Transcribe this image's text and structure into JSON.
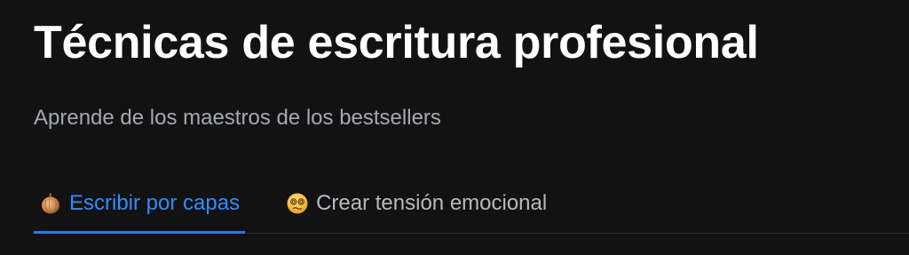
{
  "page": {
    "title": "Técnicas de escritura profesional",
    "subtitle": "Aprende de los maestros de los bestsellers"
  },
  "tabs": [
    {
      "label": "Escribir por capas",
      "icon": "onion-icon",
      "active": true
    },
    {
      "label": "Crear tensión emocional",
      "icon": "dizzy-face-icon",
      "active": false
    }
  ],
  "colors": {
    "background": "#121213",
    "title": "#ffffff",
    "subtitle": "#a3a8b2",
    "tab_active": "#2f8cff",
    "tab_inactive": "#b6b9bf",
    "tab_underline": "#1f7cf2"
  }
}
